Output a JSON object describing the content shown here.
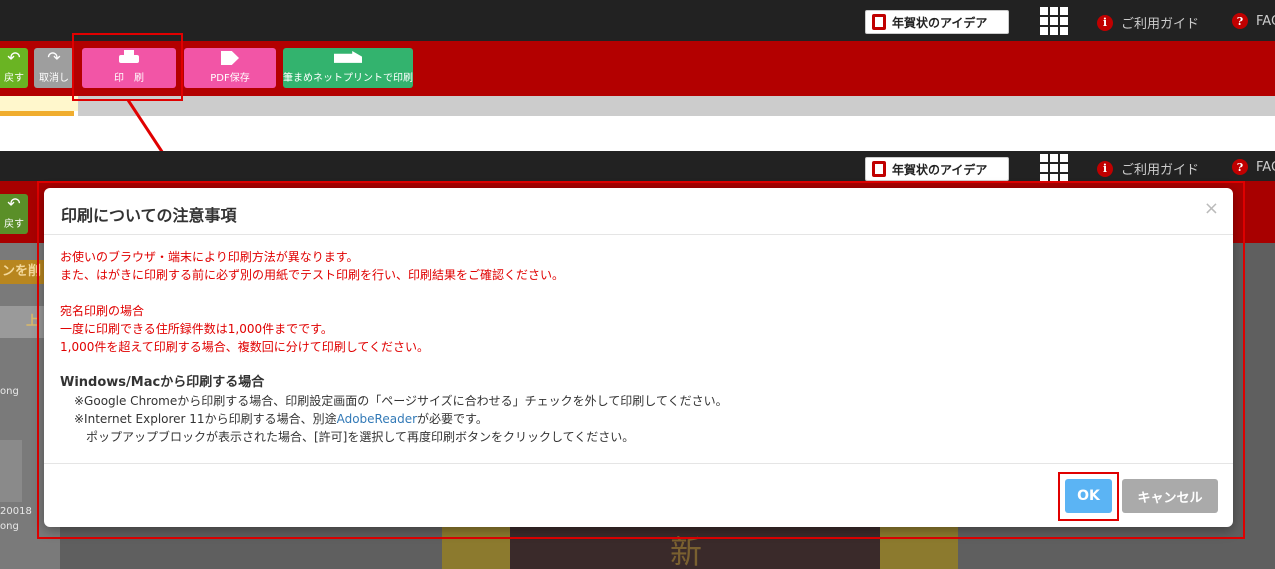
{
  "header": {
    "idea_label": "年賀状のアイデア",
    "guide_label": "ご利用ガイド",
    "faq_label": "FAQ"
  },
  "toolbar": {
    "undo_label": "戻す",
    "redo_label": "取消し",
    "print_label": "印　刷",
    "pdf_label": "PDF保存",
    "netprint_label": "筆まめネットプリントで印刷"
  },
  "background": {
    "side_text_1": "ンを削",
    "side_text_2": "上",
    "side_text_3": "ong",
    "side_text_4": "20018",
    "side_text_5": "ong",
    "card_char": "新"
  },
  "dialog": {
    "title": "印刷についての注意事項",
    "close_glyph": "×",
    "notice_line1": "お使いのブラウザ・端末により印刷方法が異なります。",
    "notice_line2": "また、はがきに印刷する前に必ず別の用紙でテスト印刷を行い、印刷結果をご確認ください。",
    "address_heading": "宛名印刷の場合",
    "address_line1": "一度に印刷できる住所録件数は1,000件までです。",
    "address_line2": "1,000件を超えて印刷する場合、複数回に分けて印刷してください。",
    "win_heading": "Windows/Macから印刷する場合",
    "chrome_line": "※Google Chromeから印刷する場合、印刷設定画面の「ページサイズに合わせる」チェックを外して印刷してください。",
    "ie_line_prefix": "※Internet Explorer 11から印刷する場合、別途",
    "ie_link": "AdobeReader",
    "ie_line_suffix": "が必要です。",
    "popup_line": "ポップアップブロックが表示された場合、[許可]を選択して再度印刷ボタンをクリックしてください。",
    "ok_label": "OK",
    "cancel_label": "キャンセル"
  },
  "colors": {
    "annotation": "#e00000",
    "toolbar": "#b30000",
    "print_button": "#f255a6",
    "netprint_button": "#33b36e",
    "ok_button": "#5bb4f4"
  }
}
